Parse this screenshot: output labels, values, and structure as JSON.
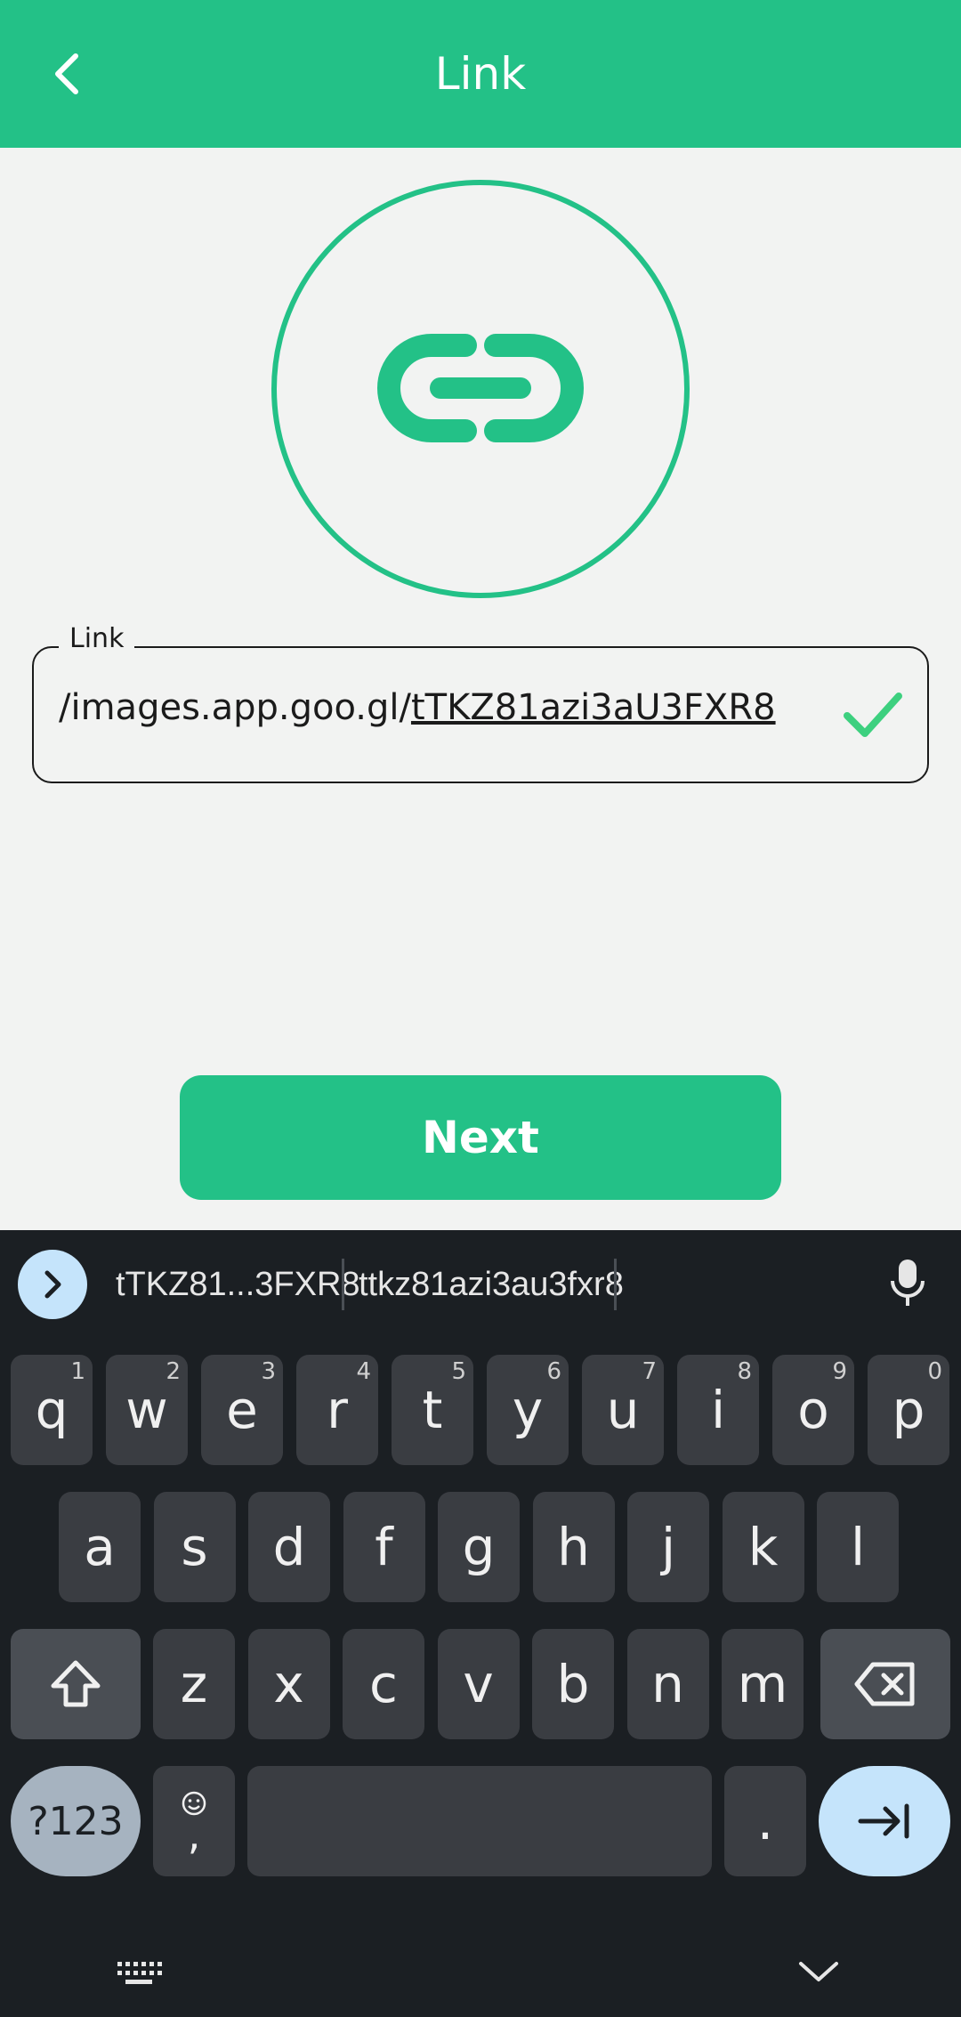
{
  "appbar": {
    "title": "Link",
    "back_icon": "chevron-left-icon"
  },
  "hero": {
    "icon": "link-icon"
  },
  "link_field": {
    "label": "Link",
    "value_prefix": "/images.app.goo.gl/",
    "value_underlined": "tTKZ81azi3aU3FXR8",
    "status_icon": "check-icon"
  },
  "next_button": {
    "label": "Next"
  },
  "keyboard": {
    "suggestions": [
      "tTKZ81...3FXR8",
      "ttkz81azi3au3fxr8"
    ],
    "row1": [
      {
        "k": "q",
        "h": "1"
      },
      {
        "k": "w",
        "h": "2"
      },
      {
        "k": "e",
        "h": "3"
      },
      {
        "k": "r",
        "h": "4"
      },
      {
        "k": "t",
        "h": "5"
      },
      {
        "k": "y",
        "h": "6"
      },
      {
        "k": "u",
        "h": "7"
      },
      {
        "k": "i",
        "h": "8"
      },
      {
        "k": "o",
        "h": "9"
      },
      {
        "k": "p",
        "h": "0"
      }
    ],
    "row2": [
      "a",
      "s",
      "d",
      "f",
      "g",
      "h",
      "j",
      "k",
      "l"
    ],
    "row3": [
      "z",
      "x",
      "c",
      "v",
      "b",
      "n",
      "m"
    ],
    "symbols_label": "?123",
    "comma_label": ",",
    "period_label": "."
  },
  "colors": {
    "primary": "#23c187",
    "check": "#3dd07f",
    "keyboard_bg": "#1b1f23",
    "key_bg": "#3a3d42",
    "accent_key": "#c5e4fb"
  }
}
